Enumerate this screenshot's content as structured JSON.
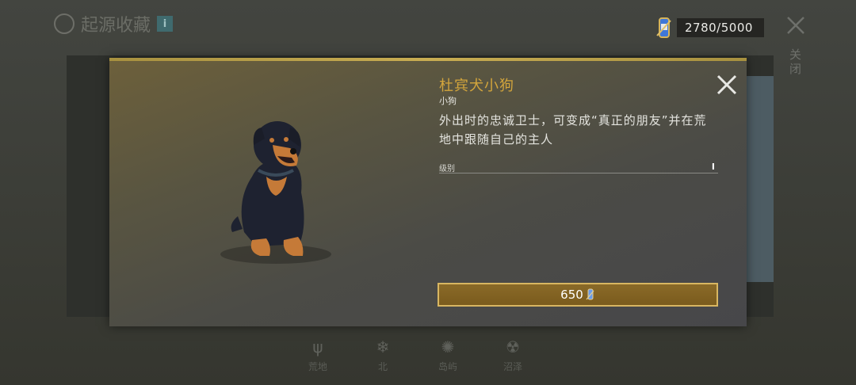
{
  "background": {
    "title": "起源收藏",
    "info_label": "i",
    "close_label": "关闭",
    "tabs": [
      {
        "label": "荒地",
        "icon": "grass-icon"
      },
      {
        "label": "北",
        "icon": "snowflake-icon"
      },
      {
        "label": "岛屿",
        "icon": "splash-icon"
      },
      {
        "label": "沼泽",
        "icon": "radiation-icon"
      }
    ]
  },
  "currency": {
    "amount": "2780/5000",
    "icon": "parts-can-icon"
  },
  "item": {
    "title": "杜宾犬小狗",
    "subtitle": "小狗",
    "description": "外出时的忠诚卫士，可变成“真正的朋友”并在荒地中跟随自己的主人",
    "level_label": "级别",
    "level_cursor": "I",
    "price": "650",
    "price_icon": "parts-can-icon"
  },
  "colors": {
    "accent_gold": "#d3a53c",
    "button_fill": "#7a5b1d",
    "button_border": "#d8b661"
  }
}
